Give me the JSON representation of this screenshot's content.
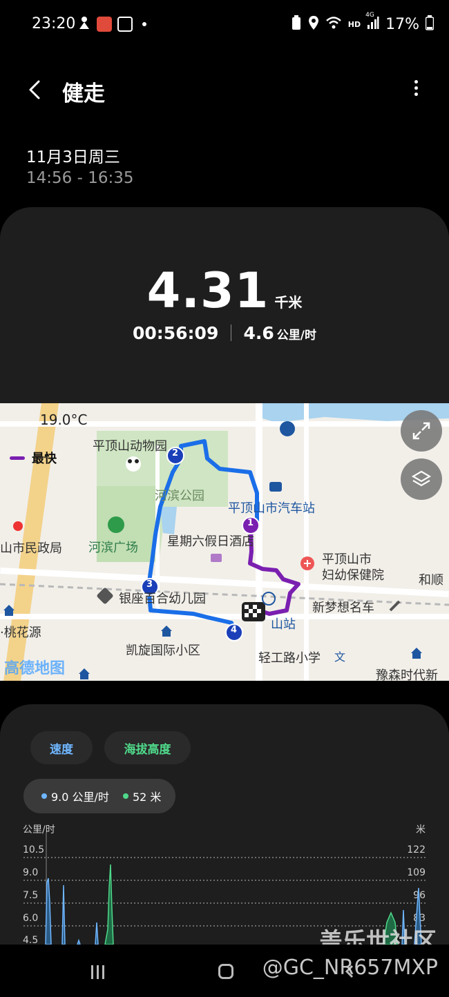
{
  "status_bar": {
    "time": "23:20",
    "battery": "17%",
    "hd": "HD",
    "net": "4G"
  },
  "header": {
    "title": "健走"
  },
  "session": {
    "date": "11月3日周三",
    "time_range": "14:56 - 16:35"
  },
  "summary": {
    "distance": "4.31",
    "distance_unit": "千米",
    "duration": "00:56:09",
    "speed": "4.6",
    "speed_unit": "公里/时"
  },
  "map": {
    "temperature": "19.0°C",
    "legend_fastest": "最快",
    "watermark": "高德地图",
    "labels": {
      "zoo": "平顶山动物园",
      "park": "河滨公园",
      "bus_station": "平顶山市汽车站",
      "hotel": "星期六假日酒店",
      "hospital_1": "平顶山市",
      "hospital_2": "妇幼保健院",
      "square": "河滨广场",
      "civil_affairs": "山市民政局",
      "kindergarten": "银座百合幼儿园",
      "station": "山站",
      "xinmeng": "新梦想名车",
      "taohuayuan": "·桃花源",
      "kaixuan": "凯旋国际小区",
      "school": "轻工路小学",
      "yusen": "豫森时代新",
      "heshun": "和顺"
    },
    "markers": [
      "1",
      "2",
      "3",
      "4"
    ],
    "route_colors": {
      "slow": "#1a6ee8",
      "fast": "#7a1fb0"
    }
  },
  "chart": {
    "tabs": {
      "speed": "速度",
      "altitude": "海拔高度"
    },
    "tooltip": {
      "speed": "9.0 公里/时",
      "altitude": "52 米"
    },
    "left_unit": "公里/时",
    "right_unit": "米",
    "left_ticks": [
      "10.5",
      "9.0",
      "7.5",
      "6.0",
      "4.5"
    ],
    "right_ticks": [
      "122",
      "109",
      "96",
      "83"
    ],
    "colors": {
      "speed": "#6fb6ff",
      "altitude": "#4fd98a"
    }
  },
  "watermarks": {
    "forum": "盖乐世社区",
    "user": "@GC_NR657MXP"
  }
}
